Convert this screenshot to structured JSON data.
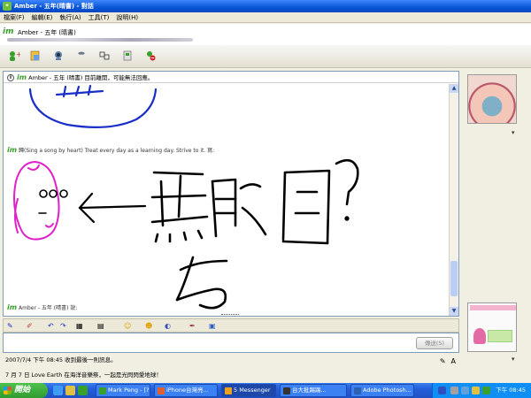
{
  "window": {
    "title": "Amber - 五年(晴書) - 對話",
    "title_icon": "messenger-icon"
  },
  "menu": [
    "檔案(F)",
    "編輯(E)",
    "執行(A)",
    "工具(T)",
    "說明(H)"
  ],
  "contact": {
    "logo": "im",
    "name": "Amber - 五年 (晴書)"
  },
  "toolbar": {
    "buttons": [
      "invite-icon",
      "send-file-icon",
      "webcam-icon",
      "call-icon",
      "activities-icon",
      "games-icon",
      "block-icon"
    ]
  },
  "chat": {
    "info_logo": "im",
    "info_text": "Amber - 五年 (晴書) 目前離開，可能無法回應。",
    "msg1_logo": "im",
    "msg1_text": "歸(Sing a song by heart) Treat every day as a learning day. Strive to it. 寫:",
    "drawing_text": "黑眼圈?",
    "msg2_logo": "im",
    "msg2_text": "Amber - 五年 (晴書) 說:"
  },
  "input": {
    "send_label": "傳送(S)"
  },
  "status": {
    "last_message": "2007/7/4 下午 08:45 收到最後一則訊息。"
  },
  "ticker": {
    "text": "7 月 7 日 Love Earth 在海洋音樂祭，一起是光閃閃愛地球！"
  },
  "taskbar": {
    "start_label": "開始",
    "tasks": [
      {
        "label": "Mark Peng - [?..."
      },
      {
        "label": "iPhone台灣亮..."
      },
      {
        "label": "5 Messenger"
      },
      {
        "label": "台大批踢踢..."
      },
      {
        "label": "Adobe Photosh..."
      }
    ],
    "clock": "下午 08:45"
  },
  "colors": {
    "accent": "#245edb",
    "im_green": "#3aa02c",
    "pen_blue": "#1a2fc8",
    "pen_magenta": "#e020c8",
    "pen_black": "#000000"
  }
}
